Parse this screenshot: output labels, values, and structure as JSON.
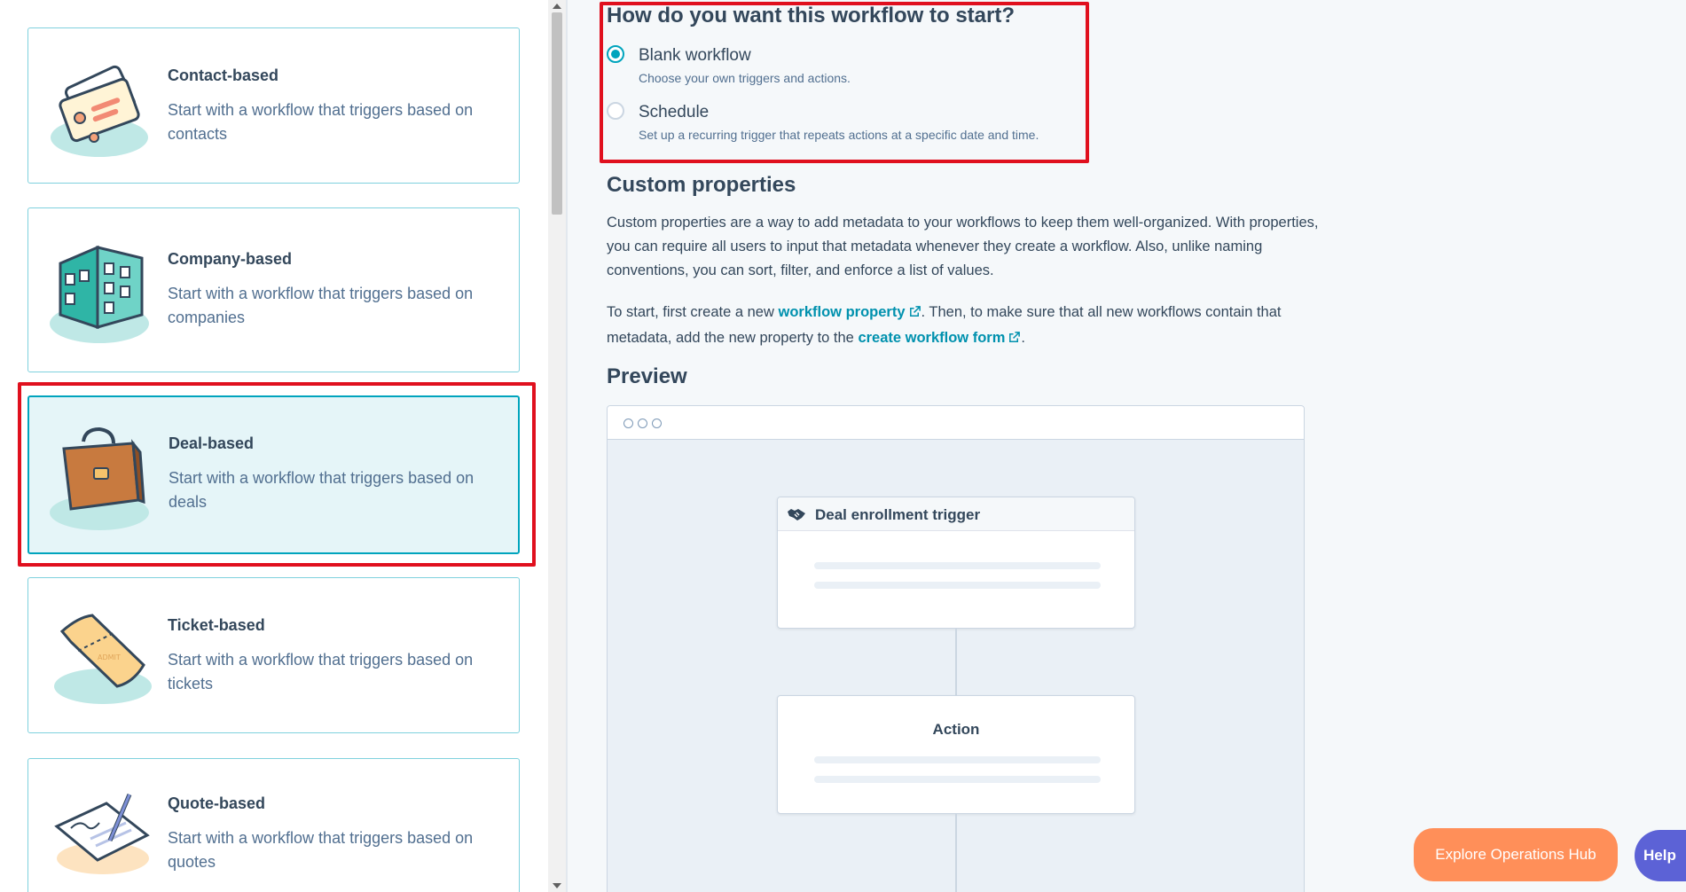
{
  "cards": [
    {
      "title": "Contact-based",
      "description": "Start with a workflow that triggers based on contacts",
      "selected": false
    },
    {
      "title": "Company-based",
      "description": "Start with a workflow that triggers based on companies",
      "selected": false
    },
    {
      "title": "Deal-based",
      "description": "Start with a workflow that triggers based on deals",
      "selected": true
    },
    {
      "title": "Ticket-based",
      "description": "Start with a workflow that triggers based on tickets",
      "selected": false
    },
    {
      "title": "Quote-based",
      "description": "Start with a workflow that triggers based on quotes",
      "selected": false
    }
  ],
  "start": {
    "question": "How do you want this workflow to start?",
    "options": [
      {
        "label": "Blank workflow",
        "help": "Choose your own triggers and actions.",
        "checked": true
      },
      {
        "label": "Schedule",
        "help": "Set up a recurring trigger that repeats actions at a specific date and time.",
        "checked": false
      }
    ]
  },
  "custom_properties": {
    "heading": "Custom properties",
    "paragraph1": "Custom properties are a way to add metadata to your workflows to keep them well-organized. With properties, you can require all users to input that metadata whenever they create a workflow. Also, unlike naming conventions, you can sort, filter, and enforce a list of values.",
    "p2_before": "To start, first create a new ",
    "p2_link1": "workflow property",
    "p2_middle": ". Then, to make sure that all new workflows contain that metadata, add the new property to the ",
    "p2_link2": "create workflow form",
    "p2_after": "."
  },
  "preview": {
    "heading": "Preview",
    "trigger_title": "Deal enrollment trigger",
    "action_title": "Action"
  },
  "buttons": {
    "explore": "Explore Operations Hub",
    "help": "Help"
  },
  "colors": {
    "accent": "#00a4bd",
    "link": "#0091ae",
    "highlight": "#e0101e",
    "explore": "#ff8f59",
    "help": "#5c62d6"
  }
}
